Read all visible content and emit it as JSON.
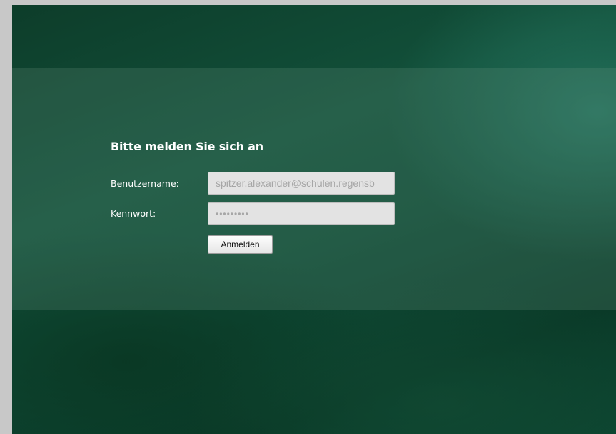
{
  "login": {
    "title": "Bitte melden Sie sich an",
    "username_label": "Benutzername:",
    "username_value": "spitzer.alexander@schulen.regensb",
    "password_label": "Kennwort:",
    "password_masked": "•••••••••",
    "submit_label": "Anmelden"
  },
  "colors": {
    "background_dark": "#0d3d2a",
    "background_accent": "#328c78",
    "input_background": "#e3e3e3",
    "text_light": "#ffffff"
  }
}
